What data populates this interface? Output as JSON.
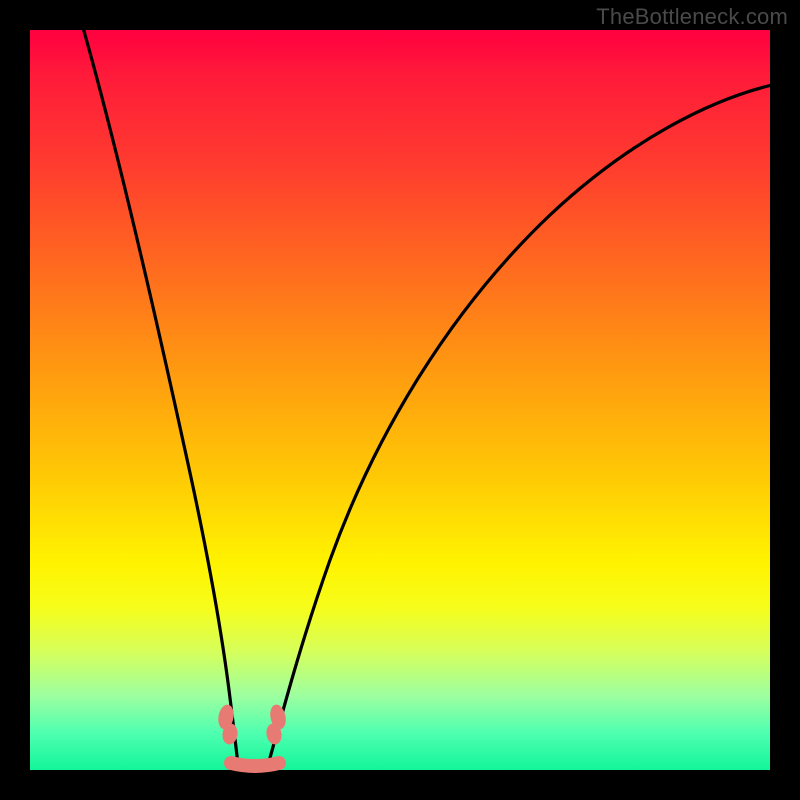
{
  "watermark": "TheBottleneck.com",
  "colors": {
    "page_bg": "#000000",
    "gradient_top": "#ff0040",
    "gradient_bottom": "#12f59a",
    "curve": "#000000",
    "marker": "#e77b74"
  },
  "chart_data": {
    "type": "line",
    "title": "",
    "xlabel": "",
    "ylabel": "",
    "xlim": [
      0,
      100
    ],
    "ylim": [
      0,
      100
    ],
    "annotations": [
      "TheBottleneck.com"
    ],
    "series": [
      {
        "name": "left-branch",
        "x": [
          7,
          10,
          13,
          16,
          19,
          22,
          24,
          26,
          27,
          28
        ],
        "y": [
          100,
          82,
          64,
          47,
          32,
          19,
          11,
          5,
          2,
          0
        ]
      },
      {
        "name": "right-branch",
        "x": [
          32,
          34,
          37,
          41,
          46,
          52,
          59,
          67,
          76,
          86,
          100
        ],
        "y": [
          0,
          3,
          9,
          19,
          31,
          43,
          55,
          67,
          77,
          85,
          92
        ]
      }
    ],
    "markers": [
      {
        "name": "left-nub",
        "x": 26.5,
        "y": 7
      },
      {
        "name": "right-nub",
        "x": 33.5,
        "y": 7
      },
      {
        "name": "flat-nub",
        "x_range": [
          27.5,
          33.5
        ],
        "y": 0.8
      }
    ],
    "legend": null,
    "grid": false
  }
}
